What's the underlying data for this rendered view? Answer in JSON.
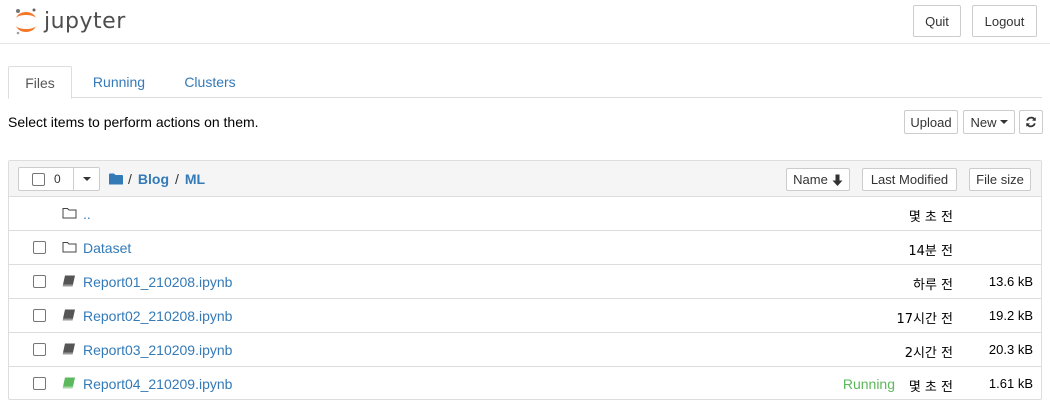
{
  "header": {
    "logo_text": "jupyter",
    "quit_label": "Quit",
    "logout_label": "Logout"
  },
  "tabs": [
    {
      "label": "Files",
      "active": true
    },
    {
      "label": "Running",
      "active": false
    },
    {
      "label": "Clusters",
      "active": false
    }
  ],
  "toolbar": {
    "hint": "Select items to perform actions on them.",
    "upload_label": "Upload",
    "new_label": "New"
  },
  "list_header": {
    "selected_count": "0",
    "breadcrumb": [
      "Blog",
      "ML"
    ],
    "name_label": "Name",
    "last_modified_label": "Last Modified",
    "file_size_label": "File size"
  },
  "rows": [
    {
      "type": "parent",
      "name": "..",
      "status": "",
      "modified": "몇 초 전",
      "size": ""
    },
    {
      "type": "folder",
      "name": "Dataset",
      "status": "",
      "modified": "14분 전",
      "size": ""
    },
    {
      "type": "notebook",
      "name": "Report01_210208.ipynb",
      "status": "",
      "modified": "하루 전",
      "size": "13.6 kB"
    },
    {
      "type": "notebook",
      "name": "Report02_210208.ipynb",
      "status": "",
      "modified": "17시간 전",
      "size": "19.2 kB"
    },
    {
      "type": "notebook",
      "name": "Report03_210209.ipynb",
      "status": "",
      "modified": "2시간 전",
      "size": "20.3 kB"
    },
    {
      "type": "notebook-running",
      "name": "Report04_210209.ipynb",
      "status": "Running",
      "modified": "몇 초 전",
      "size": "1.61 kB"
    }
  ],
  "colors": {
    "link": "#337ab7",
    "running": "#5cb85c",
    "logo_orange": "#f37726",
    "logo_text": "#4e4e4e"
  },
  "icons": {
    "folder": "folder-icon",
    "notebook": "notebook-icon",
    "refresh": "refresh-icon",
    "sort_down": "arrow-down-icon"
  }
}
